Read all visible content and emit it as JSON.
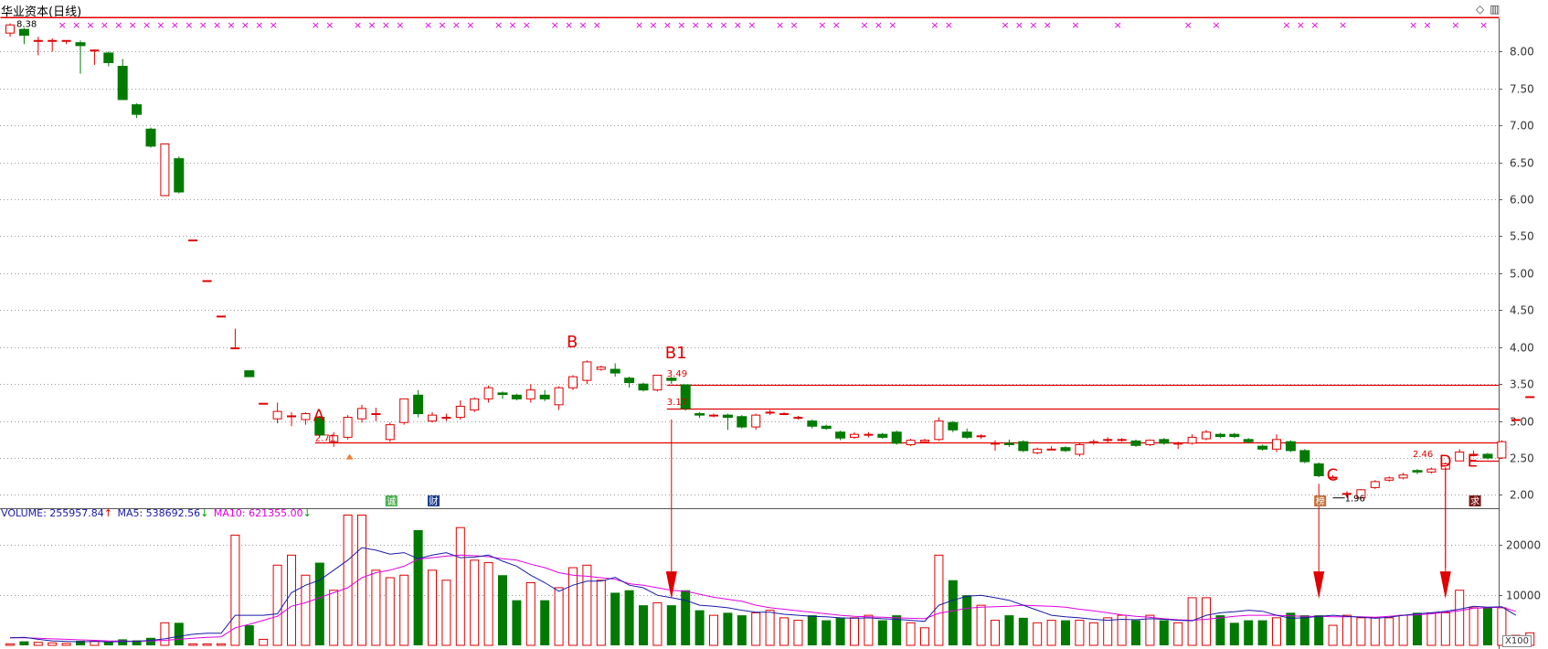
{
  "title": "华业资本(日线)",
  "corner_icons": [
    "diamond-icon",
    "window-icon"
  ],
  "window_controls": {
    "diamond": "◇",
    "window": "▥"
  },
  "price_axis_ticks": [
    "8.00",
    "7.50",
    "7.00",
    "6.50",
    "6.00",
    "5.50",
    "5.00",
    "4.50",
    "4.00",
    "3.50",
    "3.00",
    "2.50",
    "2.00"
  ],
  "volume_axis_ticks": [
    "20000",
    "10000"
  ],
  "volume_unit": "X100",
  "volume_legend": [
    {
      "key": "VOLUME: 255957.84",
      "arrow": "↑",
      "color": "#1a1aa8",
      "arrow_color": "#e00000"
    },
    {
      "key": "MA5: 538692.56",
      "arrow": "↓",
      "color": "#1a1aa8",
      "arrow_color": "#009900"
    },
    {
      "key": "MA10: 621355.00",
      "arrow": "↓",
      "color": "#e000e0",
      "arrow_color": "#009900"
    }
  ],
  "colors": {
    "up": "#e00000",
    "down": "#007a00",
    "ma5": "#1a1aa8",
    "ma10": "#e000e0",
    "grid": "#9a9a9a",
    "ref_line": "#e00000",
    "arrow": "#e00000",
    "xmark": "#e000e0"
  },
  "tags": [
    {
      "text": "诚",
      "bg": "#4caf50",
      "i": 27
    },
    {
      "text": "财",
      "bg": "#1f3f8f",
      "i": 30
    },
    {
      "text": "榜",
      "bg": "#c0703a",
      "i": 93
    },
    {
      "text": "求",
      "bg": "#7a1a1a",
      "i": 104
    }
  ],
  "chart_data": {
    "type": "candlestick",
    "title": "华业资本(日线)",
    "ylim": [
      1.82,
      8.45
    ],
    "volume_ylim": [
      0,
      27000
    ],
    "annotations": [
      {
        "label": "A",
        "i": 22,
        "price": 3.0
      },
      {
        "label": "B",
        "i": 40,
        "price": 4.0
      },
      {
        "label": "B1",
        "i": 47,
        "price": 3.85
      },
      {
        "label": "C",
        "i": 94,
        "price": 2.2
      },
      {
        "label": "D",
        "i": 102,
        "price": 2.38
      },
      {
        "label": "E",
        "i": 104,
        "price": 2.38
      }
    ],
    "price_labels": [
      {
        "text": "8.38",
        "i": 0,
        "price": 8.38
      },
      {
        "text": "2.71",
        "i": 22,
        "price": 2.78
      },
      {
        "text": "3.49",
        "i": 47,
        "price": 3.65
      },
      {
        "text": "3.17",
        "i": 47,
        "price": 3.27
      },
      {
        "text": "1.96",
        "i": 94,
        "price": 1.96
      },
      {
        "text": "2.46",
        "i": 100,
        "price": 2.56
      }
    ],
    "reference_lines": [
      3.49,
      3.17,
      2.71,
      2.46
    ],
    "arrows": [
      {
        "i": 47
      },
      {
        "i": 93
      },
      {
        "i": 102
      }
    ],
    "volume_arrows": [
      {
        "i": 47
      },
      {
        "i": 93
      },
      {
        "i": 102
      }
    ],
    "x_markers": [
      4,
      5,
      6,
      7,
      8,
      9,
      10,
      11,
      12,
      13,
      14,
      15,
      16,
      17,
      18,
      19,
      22,
      23,
      25,
      26,
      27,
      28,
      30,
      31,
      32,
      33,
      35,
      36,
      37,
      39,
      40,
      41,
      42,
      45,
      46,
      47,
      48,
      49,
      50,
      51,
      52,
      53,
      55,
      56,
      58,
      59,
      61,
      62,
      63,
      66,
      67,
      71,
      72,
      73,
      74,
      76,
      79,
      84,
      86,
      91,
      92,
      93,
      95,
      100,
      101,
      103,
      105
    ],
    "candles": [
      {
        "o": 8.25,
        "c": 8.36,
        "h": 8.38,
        "l": 8.2,
        "v": 300
      },
      {
        "o": 8.3,
        "c": 8.22,
        "h": 8.32,
        "l": 8.1,
        "v": 800
      },
      {
        "o": 8.15,
        "c": 8.15,
        "h": 8.2,
        "l": 7.95,
        "v": 600
      },
      {
        "o": 8.15,
        "c": 8.15,
        "h": 8.18,
        "l": 8.0,
        "v": 500
      },
      {
        "o": 8.15,
        "c": 8.15,
        "h": 8.15,
        "l": 8.1,
        "v": 400
      },
      {
        "o": 8.12,
        "c": 8.08,
        "h": 8.15,
        "l": 7.7,
        "v": 900
      },
      {
        "o": 8.02,
        "c": 8.02,
        "h": 8.03,
        "l": 7.82,
        "v": 800
      },
      {
        "o": 7.98,
        "c": 7.85,
        "h": 8.0,
        "l": 7.8,
        "v": 700
      },
      {
        "o": 7.8,
        "c": 7.35,
        "h": 7.9,
        "l": 7.35,
        "v": 1200
      },
      {
        "o": 7.28,
        "c": 7.15,
        "h": 7.3,
        "l": 7.1,
        "v": 1000
      },
      {
        "o": 6.95,
        "c": 6.72,
        "h": 6.97,
        "l": 6.7,
        "v": 1500
      },
      {
        "o": 6.05,
        "c": 6.75,
        "h": 6.75,
        "l": 6.05,
        "v": 4500
      },
      {
        "o": 6.55,
        "c": 6.1,
        "h": 6.58,
        "l": 6.08,
        "v": 4500
      },
      {
        "o": 5.45,
        "c": 5.45,
        "h": 5.45,
        "l": 5.45,
        "v": 300
      },
      {
        "o": 4.9,
        "c": 4.9,
        "h": 4.9,
        "l": 4.9,
        "v": 300
      },
      {
        "o": 4.42,
        "c": 4.42,
        "h": 4.42,
        "l": 4.42,
        "v": 300
      },
      {
        "o": 3.99,
        "c": 3.99,
        "h": 4.25,
        "l": 3.99,
        "v": 22000
      },
      {
        "o": 3.68,
        "c": 3.6,
        "h": 3.68,
        "l": 3.6,
        "v": 4000
      },
      {
        "o": 3.24,
        "c": 3.24,
        "h": 3.24,
        "l": 3.24,
        "v": 1200
      },
      {
        "o": 3.03,
        "c": 3.13,
        "h": 3.25,
        "l": 2.97,
        "v": 16000
      },
      {
        "o": 3.07,
        "c": 3.07,
        "h": 3.12,
        "l": 2.93,
        "v": 18000
      },
      {
        "o": 3.02,
        "c": 3.1,
        "h": 3.12,
        "l": 2.95,
        "v": 14000
      },
      {
        "o": 3.05,
        "c": 2.81,
        "h": 3.07,
        "l": 2.78,
        "v": 16500
      },
      {
        "o": 2.72,
        "c": 2.8,
        "h": 2.85,
        "l": 2.65,
        "v": 11000
      },
      {
        "o": 2.78,
        "c": 3.05,
        "h": 3.08,
        "l": 2.75,
        "v": 26000
      },
      {
        "o": 3.03,
        "c": 3.17,
        "h": 3.22,
        "l": 2.98,
        "v": 26000
      },
      {
        "o": 3.1,
        "c": 3.1,
        "h": 3.18,
        "l": 3.0,
        "v": 15000
      },
      {
        "o": 2.75,
        "c": 2.95,
        "h": 2.98,
        "l": 2.72,
        "v": 13500
      },
      {
        "o": 2.98,
        "c": 3.3,
        "h": 3.3,
        "l": 2.95,
        "v": 14000
      },
      {
        "o": 3.35,
        "c": 3.1,
        "h": 3.42,
        "l": 3.05,
        "v": 23000
      },
      {
        "o": 3.0,
        "c": 3.08,
        "h": 3.12,
        "l": 2.98,
        "v": 15000
      },
      {
        "o": 3.05,
        "c": 3.05,
        "h": 3.1,
        "l": 3.0,
        "v": 13000
      },
      {
        "o": 3.05,
        "c": 3.2,
        "h": 3.28,
        "l": 3.02,
        "v": 23500
      },
      {
        "o": 3.15,
        "c": 3.3,
        "h": 3.32,
        "l": 3.12,
        "v": 17000
      },
      {
        "o": 3.3,
        "c": 3.45,
        "h": 3.48,
        "l": 3.25,
        "v": 16500
      },
      {
        "o": 3.38,
        "c": 3.36,
        "h": 3.4,
        "l": 3.3,
        "v": 14000
      },
      {
        "o": 3.35,
        "c": 3.3,
        "h": 3.37,
        "l": 3.28,
        "v": 9000
      },
      {
        "o": 3.3,
        "c": 3.42,
        "h": 3.5,
        "l": 3.25,
        "v": 12500
      },
      {
        "o": 3.35,
        "c": 3.3,
        "h": 3.42,
        "l": 3.27,
        "v": 9000
      },
      {
        "o": 3.22,
        "c": 3.45,
        "h": 3.47,
        "l": 3.15,
        "v": 11500
      },
      {
        "o": 3.45,
        "c": 3.6,
        "h": 3.62,
        "l": 3.42,
        "v": 15500
      },
      {
        "o": 3.55,
        "c": 3.8,
        "h": 3.82,
        "l": 3.5,
        "v": 16000
      },
      {
        "o": 3.7,
        "c": 3.73,
        "h": 3.75,
        "l": 3.68,
        "v": 13000
      },
      {
        "o": 3.7,
        "c": 3.65,
        "h": 3.78,
        "l": 3.6,
        "v": 10500
      },
      {
        "o": 3.58,
        "c": 3.52,
        "h": 3.6,
        "l": 3.45,
        "v": 11000
      },
      {
        "o": 3.5,
        "c": 3.42,
        "h": 3.52,
        "l": 3.4,
        "v": 8000
      },
      {
        "o": 3.42,
        "c": 3.62,
        "h": 3.62,
        "l": 3.4,
        "v": 8500
      },
      {
        "o": 3.58,
        "c": 3.55,
        "h": 3.6,
        "l": 3.5,
        "v": 8000
      },
      {
        "o": 3.49,
        "c": 3.17,
        "h": 3.49,
        "l": 3.14,
        "v": 11000
      },
      {
        "o": 3.1,
        "c": 3.08,
        "h": 3.12,
        "l": 3.04,
        "v": 7000
      },
      {
        "o": 3.08,
        "c": 3.08,
        "h": 3.1,
        "l": 3.05,
        "v": 6000
      },
      {
        "o": 3.08,
        "c": 3.05,
        "h": 3.1,
        "l": 2.88,
        "v": 6500
      },
      {
        "o": 3.06,
        "c": 2.92,
        "h": 3.08,
        "l": 2.9,
        "v": 6000
      },
      {
        "o": 2.92,
        "c": 3.08,
        "h": 3.1,
        "l": 2.88,
        "v": 6500
      },
      {
        "o": 3.12,
        "c": 3.12,
        "h": 3.15,
        "l": 3.08,
        "v": 7000
      },
      {
        "o": 3.1,
        "c": 3.1,
        "h": 3.12,
        "l": 3.08,
        "v": 5500
      },
      {
        "o": 3.05,
        "c": 3.05,
        "h": 3.07,
        "l": 3.02,
        "v": 5000
      },
      {
        "o": 3.0,
        "c": 2.93,
        "h": 3.02,
        "l": 2.9,
        "v": 6000
      },
      {
        "o": 2.93,
        "c": 2.9,
        "h": 2.95,
        "l": 2.88,
        "v": 5000
      },
      {
        "o": 2.85,
        "c": 2.77,
        "h": 2.87,
        "l": 2.74,
        "v": 5500
      },
      {
        "o": 2.78,
        "c": 2.82,
        "h": 2.85,
        "l": 2.76,
        "v": 5500
      },
      {
        "o": 2.82,
        "c": 2.82,
        "h": 2.85,
        "l": 2.78,
        "v": 6000
      },
      {
        "o": 2.82,
        "c": 2.78,
        "h": 2.84,
        "l": 2.76,
        "v": 5000
      },
      {
        "o": 2.85,
        "c": 2.7,
        "h": 2.87,
        "l": 2.68,
        "v": 6000
      },
      {
        "o": 2.68,
        "c": 2.74,
        "h": 2.76,
        "l": 2.66,
        "v": 4500
      },
      {
        "o": 2.72,
        "c": 2.74,
        "h": 2.76,
        "l": 2.7,
        "v": 3500
      },
      {
        "o": 2.75,
        "c": 3.0,
        "h": 3.05,
        "l": 2.73,
        "v": 18000
      },
      {
        "o": 2.98,
        "c": 2.88,
        "h": 3.0,
        "l": 2.85,
        "v": 13000
      },
      {
        "o": 2.85,
        "c": 2.78,
        "h": 2.9,
        "l": 2.76,
        "v": 10000
      },
      {
        "o": 2.8,
        "c": 2.8,
        "h": 2.82,
        "l": 2.76,
        "v": 8000
      },
      {
        "o": 2.7,
        "c": 2.7,
        "h": 2.74,
        "l": 2.6,
        "v": 5000
      },
      {
        "o": 2.7,
        "c": 2.68,
        "h": 2.75,
        "l": 2.65,
        "v": 6000
      },
      {
        "o": 2.72,
        "c": 2.6,
        "h": 2.74,
        "l": 2.58,
        "v": 5500
      },
      {
        "o": 2.57,
        "c": 2.62,
        "h": 2.64,
        "l": 2.55,
        "v": 4500
      },
      {
        "o": 2.62,
        "c": 2.62,
        "h": 2.66,
        "l": 2.6,
        "v": 5000
      },
      {
        "o": 2.64,
        "c": 2.6,
        "h": 2.66,
        "l": 2.58,
        "v": 5000
      },
      {
        "o": 2.55,
        "c": 2.68,
        "h": 2.7,
        "l": 2.52,
        "v": 5000
      },
      {
        "o": 2.72,
        "c": 2.72,
        "h": 2.75,
        "l": 2.68,
        "v": 4500
      },
      {
        "o": 2.75,
        "c": 2.75,
        "h": 2.78,
        "l": 2.7,
        "v": 5500
      },
      {
        "o": 2.75,
        "c": 2.75,
        "h": 2.77,
        "l": 2.72,
        "v": 6000
      },
      {
        "o": 2.73,
        "c": 2.67,
        "h": 2.75,
        "l": 2.65,
        "v": 5000
      },
      {
        "o": 2.68,
        "c": 2.74,
        "h": 2.75,
        "l": 2.66,
        "v": 6000
      },
      {
        "o": 2.75,
        "c": 2.7,
        "h": 2.77,
        "l": 2.68,
        "v": 5000
      },
      {
        "o": 2.7,
        "c": 2.7,
        "h": 2.72,
        "l": 2.62,
        "v": 4500
      },
      {
        "o": 2.7,
        "c": 2.78,
        "h": 2.82,
        "l": 2.68,
        "v": 9500
      },
      {
        "o": 2.76,
        "c": 2.85,
        "h": 2.88,
        "l": 2.74,
        "v": 9500
      },
      {
        "o": 2.82,
        "c": 2.79,
        "h": 2.84,
        "l": 2.77,
        "v": 6000
      },
      {
        "o": 2.82,
        "c": 2.79,
        "h": 2.84,
        "l": 2.77,
        "v": 4500
      },
      {
        "o": 2.75,
        "c": 2.72,
        "h": 2.77,
        "l": 2.7,
        "v": 5000
      },
      {
        "o": 2.66,
        "c": 2.62,
        "h": 2.68,
        "l": 2.6,
        "v": 5000
      },
      {
        "o": 2.62,
        "c": 2.75,
        "h": 2.82,
        "l": 2.58,
        "v": 5500
      },
      {
        "o": 2.72,
        "c": 2.6,
        "h": 2.74,
        "l": 2.58,
        "v": 6500
      },
      {
        "o": 2.6,
        "c": 2.45,
        "h": 2.62,
        "l": 2.43,
        "v": 6000
      },
      {
        "o": 2.42,
        "c": 2.26,
        "h": 2.44,
        "l": 2.24,
        "v": 6000
      },
      {
        "o": 2.24,
        "c": 2.24,
        "h": 2.27,
        "l": 2.22,
        "v": 4000
      },
      {
        "o": 2.02,
        "c": 2.02,
        "h": 2.05,
        "l": 1.96,
        "v": 6000
      },
      {
        "o": 1.96,
        "c": 2.07,
        "h": 2.08,
        "l": 1.96,
        "v": 5500
      },
      {
        "o": 2.1,
        "c": 2.18,
        "h": 2.2,
        "l": 2.08,
        "v": 5500
      },
      {
        "o": 2.2,
        "c": 2.23,
        "h": 2.25,
        "l": 2.18,
        "v": 5500
      },
      {
        "o": 2.23,
        "c": 2.27,
        "h": 2.3,
        "l": 2.21,
        "v": 6000
      },
      {
        "o": 2.33,
        "c": 2.31,
        "h": 2.35,
        "l": 2.28,
        "v": 6500
      },
      {
        "o": 2.31,
        "c": 2.35,
        "h": 2.37,
        "l": 2.29,
        "v": 6500
      },
      {
        "o": 2.35,
        "c": 2.42,
        "h": 2.44,
        "l": 2.34,
        "v": 6500
      },
      {
        "o": 2.46,
        "c": 2.58,
        "h": 2.62,
        "l": 2.46,
        "v": 11000
      },
      {
        "o": 2.55,
        "c": 2.55,
        "h": 2.6,
        "l": 2.52,
        "v": 7500
      },
      {
        "o": 2.55,
        "c": 2.5,
        "h": 2.57,
        "l": 2.48,
        "v": 7500
      },
      {
        "o": 2.5,
        "c": 2.72,
        "h": 2.74,
        "l": 2.49,
        "v": 7500
      },
      {
        "o": 3.02,
        "c": 3.02,
        "h": 3.02,
        "l": 3.02,
        "v": 2000
      },
      {
        "o": 3.33,
        "c": 3.33,
        "h": 3.33,
        "l": 3.33,
        "v": 2500
      }
    ],
    "ma5": [
      1500,
      1600,
      1200,
      900,
      800,
      700,
      800,
      700,
      750,
      800,
      1000,
      1300,
      1800,
      2200,
      2400,
      2400,
      6000,
      6000,
      6000,
      6300,
      10500,
      12000,
      13000,
      15000,
      17000,
      19500,
      19000,
      18200,
      18500,
      17300,
      18000,
      18500,
      17500,
      17600,
      18000,
      16800,
      15800,
      14000,
      12500,
      10800,
      12000,
      12800,
      12800,
      13600,
      12000,
      11500,
      10000,
      9500,
      9000,
      8000,
      7800,
      7500,
      7000,
      6600,
      6600,
      6200,
      6000,
      5800,
      5700,
      5500,
      5400,
      5500,
      5300,
      5200,
      5000,
      4800,
      8000,
      9000,
      9800,
      10000,
      9500,
      9000,
      8000,
      7000,
      6000,
      5700,
      5500,
      5200,
      5000,
      5200,
      5100,
      5300,
      5200,
      5000,
      4900,
      6000,
      6500,
      6700,
      7000,
      6800,
      6000,
      5400,
      5500,
      5800,
      6000,
      5800,
      5600,
      5400,
      5600,
      6000,
      6300,
      6500,
      6800,
      7200,
      7800,
      7600,
      7700,
      6000
    ],
    "ma10": [
      1500,
      1500,
      1400,
      1300,
      1200,
      1100,
      1000,
      900,
      850,
      800,
      900,
      1000,
      1200,
      1400,
      1600,
      1700,
      3500,
      4200,
      5000,
      5800,
      7800,
      8500,
      9500,
      10500,
      11500,
      13500,
      14500,
      15000,
      15800,
      17200,
      17500,
      17800,
      18000,
      17900,
      17700,
      17300,
      17000,
      16200,
      15500,
      14500,
      14000,
      13800,
      13500,
      13200,
      12300,
      12000,
      11500,
      11000,
      10800,
      10200,
      9600,
      9200,
      8800,
      8000,
      7500,
      7200,
      6900,
      6600,
      6300,
      6000,
      5800,
      5700,
      5600,
      5500,
      5400,
      5300,
      6400,
      6900,
      7400,
      7600,
      7700,
      7800,
      8000,
      7900,
      7800,
      7600,
      7200,
      6900,
      6500,
      6100,
      5800,
      5600,
      5300,
      5100,
      5000,
      5200,
      5500,
      5800,
      6000,
      6000,
      6000,
      5900,
      5800,
      5800,
      5700,
      5700,
      5700,
      5600,
      5800,
      6000,
      6100,
      6300,
      6600,
      6900,
      7400,
      7500,
      7600,
      6800
    ]
  }
}
